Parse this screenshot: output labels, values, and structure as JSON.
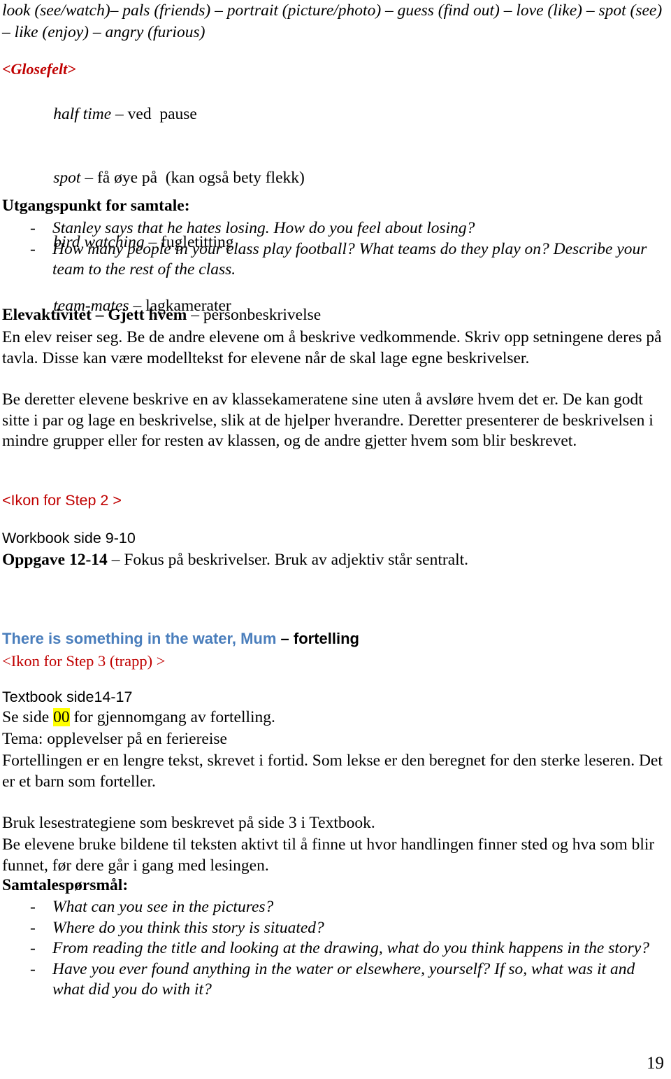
{
  "document": {
    "page_number": "19",
    "colors": {
      "red_marker": "#C00000",
      "blue_heading": "#4A7EBC",
      "highlight": "#FFFF00"
    }
  },
  "wordlist": {
    "text": "look (see/watch)– pals (friends) – portrait (picture/photo) – guess (find out) – love (like) – spot (see) – like (enjoy) – angry (furious)"
  },
  "glosefelt": {
    "heading": "<Glosefelt>",
    "entries": [
      {
        "term": "half time",
        "sep": " – ",
        "definition": "ved  pause"
      },
      {
        "term": "spot",
        "sep": " – ",
        "definition": "få øye på  (kan også bety flekk)"
      },
      {
        "term": "bird watching",
        "sep": " – ",
        "definition": "fugletitting"
      },
      {
        "term": "team-mates",
        "sep": " – ",
        "definition": "lagkamerater"
      }
    ]
  },
  "utgangspunkt": {
    "heading": "Utgangspunkt for samtale:",
    "dash": "-",
    "items": [
      "Stanley says that he hates losing. How do you feel about losing?",
      "How many people in your class play football? What teams do they play on? Describe your team to the rest of the class."
    ]
  },
  "elevaktivitet": {
    "heading_bold": "Elevaktivitet – Gjett hvem",
    "heading_rest": " – personbeskrivelse",
    "paragraph1": "En elev reiser seg. Be de andre elevene om å beskrive vedkommende. Skriv opp setningene deres på tavla. Disse kan være modelltekst for elevene når de skal lage egne beskrivelser.",
    "paragraph2": "Be deretter elevene beskrive en av klassekameratene sine uten å avsløre hvem det er. De kan godt sitte i par og lage en beskrivelse, slik at de hjelper hverandre. Deretter presenterer de beskrivelsen i mindre grupper eller for resten av klassen, og de andre gjetter hvem som blir beskrevet."
  },
  "step2": {
    "icon_note": "<Ikon for Step 2 >",
    "workbook_line": "Workbook side 9-10",
    "oppgave_bold": "Oppgave 12-14",
    "oppgave_rest": " – Fokus på beskrivelser. Bruk av adjektiv står sentralt."
  },
  "story": {
    "title_blue": "There is something in the water, Mum",
    "title_black": " – fortelling",
    "icon_note": "<Ikon for Step 3 (trapp) >",
    "textbook_line": "Textbook side14-17",
    "se_side_before": "Se side ",
    "se_side_highlight": "00",
    "se_side_after": " for gjennomgang av fortelling.",
    "tema_line": "Tema: opplevelser på en feriereise",
    "fortellingen_paragraph": "Fortellingen er en lengre tekst, skrevet i fortid. Som lekse er den beregnet for den sterke leseren. Det er et barn som forteller.",
    "bruk_line": "Bruk lesestrategiene som beskrevet på side 3 i Textbook.",
    "be_elevene_paragraph": "Be elevene bruke bildene til teksten aktivt til å finne ut hvor handlingen finner sted og hva som blir funnet, før dere går i gang med lesingen."
  },
  "samtale": {
    "heading": "Samtalespørsmål:",
    "dash": "-",
    "items": [
      "What can you see in the pictures?",
      "Where do you think this story is situated?",
      "From reading the title and looking at the drawing, what do you think happens in the story?",
      "Have you ever found anything in the water or elsewhere, yourself? If so, what was it and what did you do with it?"
    ]
  }
}
